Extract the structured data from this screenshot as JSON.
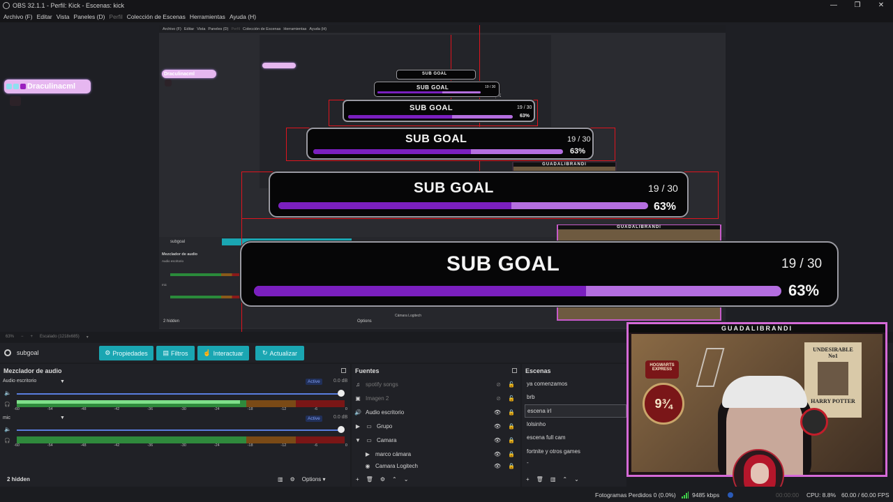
{
  "titlebar": {
    "title": "OBS 32.1.1 - Perfil: Kick - Escenas: kick",
    "minimize": "—",
    "maximize": "❐",
    "close": "✕"
  },
  "menu": {
    "items": [
      "Archivo (F)",
      "Editar",
      "Vista",
      "Paneles (D)",
      "Perfil",
      "Colección de Escenas",
      "Herramientas",
      "Ayuda (H)"
    ]
  },
  "preview": {
    "name_tag": "Draculinacml",
    "goal_title": "SUB GOAL",
    "goal_count": "19 / 30",
    "goal_percent": "63%",
    "goal_progress": 0.63,
    "size_readout": "517 px",
    "cam_label": "GUADALIBRANDI",
    "nested": {
      "menu": [
        "Archivo (F)",
        "Editar",
        "Vista",
        "Paneles (D)",
        "Perfil",
        "Colección de Escenas",
        "Herramientas",
        "Ayuda (H)"
      ],
      "source_name": "subgoal",
      "mixer_title": "Mezclador de audio",
      "channel1": "Audio escritorio",
      "channel2": "mic",
      "hidden": "2 hidden",
      "options": "Options",
      "camera_item": "Cámara Logitech"
    }
  },
  "statusline": {
    "zoom": "63%",
    "scale": "Escalado (1218x685)"
  },
  "source_toolbar": {
    "source_name": "subgoal",
    "buttons": {
      "properties": "Propiedades",
      "filters": "Filtros",
      "interact": "Interactuar",
      "refresh": "Actualizar"
    }
  },
  "mixer": {
    "title": "Mezclador de audio",
    "channels": [
      {
        "name": "Audio escritorio",
        "status": "Active",
        "db": "0.0 dB",
        "level": 0.68
      },
      {
        "name": "mic",
        "status": "Active",
        "db": "0.0 dB",
        "level": 0.0
      }
    ],
    "scale": [
      "-60",
      "-54",
      "-48",
      "-42",
      "-36",
      "-30",
      "-24",
      "-18",
      "-12",
      "-6",
      "0"
    ]
  },
  "sources": {
    "title": "Fuentes",
    "items": [
      {
        "name": "spotify songs",
        "dim": true
      },
      {
        "name": "Imagen 2",
        "dim": true
      },
      {
        "name": "Audio escritorio",
        "dim": false
      },
      {
        "name": "Grupo",
        "dim": false
      },
      {
        "name": "Camara",
        "dim": false
      },
      {
        "name": "marco cámara",
        "dim": false
      },
      {
        "name": "Camara Logitech",
        "dim": false
      }
    ],
    "footer": {
      "hidden": "2 hidden",
      "options": "Options"
    }
  },
  "scenes": {
    "title": "Escenas",
    "items": [
      "ya comenzamos",
      "brb",
      "escena irl",
      "lolsinho",
      "escena full cam",
      "fortnite y otros games",
      "-"
    ],
    "selected": 2
  },
  "webcam": {
    "label": "GUADALIBRANDI",
    "poster_title": "UNDESIRABLE",
    "poster_no": "No1",
    "poster_name": "HARRY POTTER",
    "platform": "9¾",
    "hogwarts": "HOGWARTS EXPRESS"
  },
  "statusbar": {
    "dropped": "Fotogramas Perdidos 0 (0.0%)",
    "bitrate": "9485 kbps",
    "rec_time": "00:00:00",
    "cpu": "CPU: 8.8%",
    "fps": "60.00 / 60.00 FPS"
  },
  "colors": {
    "accent": "#1aa6b2",
    "bar_fill": "#7a1fbf",
    "bar_track": "#b46ee0",
    "selection": "#e1141e",
    "cam_border": "#d56ad7"
  }
}
